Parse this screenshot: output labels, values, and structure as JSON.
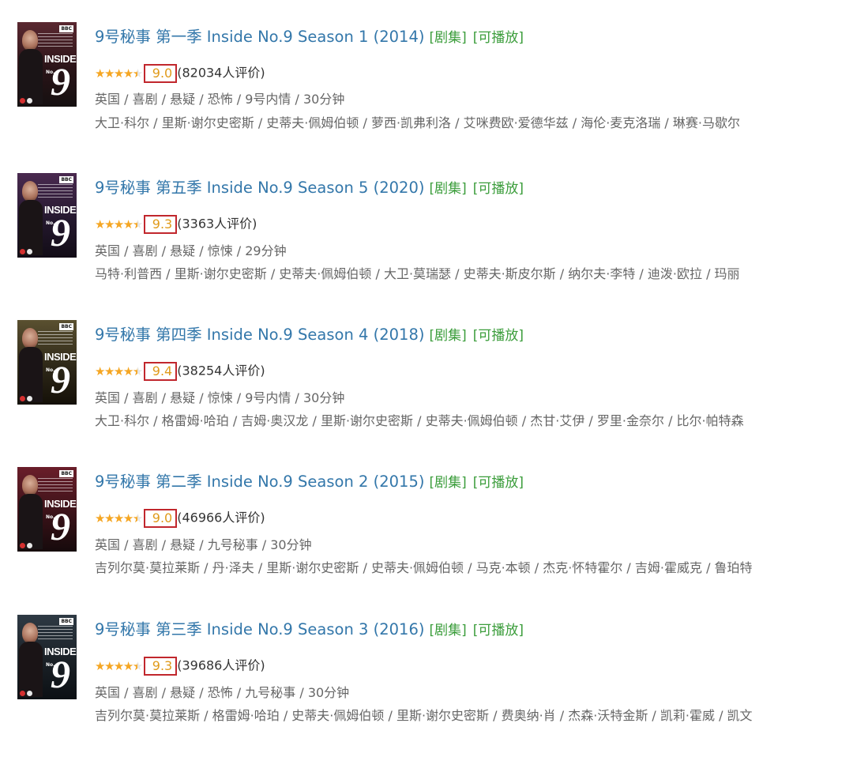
{
  "results": [
    {
      "poster": {
        "channel": "BBC",
        "title_word": "INSIDE",
        "title_number": "9",
        "title_no": "No."
      },
      "title": "9号秘事 第一季 Inside No.9 Season 1 (2014)",
      "tags": [
        "[剧集]",
        "[可播放]"
      ],
      "stars": 4.5,
      "score": "9.0",
      "count_text": "(82034人评价)",
      "meta": "英国 / 喜剧 / 悬疑 / 恐怖 / 9号内情 / 30分钟",
      "cast": "大卫·科尔 / 里斯·谢尔史密斯 / 史蒂夫·佩姆伯顿 / 萝西·凯弗利洛 / 艾咪费欧·爱德华兹 / 海伦·麦克洛瑞 / 琳赛·马歇尔"
    },
    {
      "poster": {
        "channel": "BBC",
        "title_word": "INSIDE",
        "title_number": "9",
        "title_no": "No."
      },
      "title": "9号秘事 第五季 Inside No.9 Season 5 (2020)",
      "tags": [
        "[剧集]",
        "[可播放]"
      ],
      "stars": 4.5,
      "score": "9.3",
      "count_text": "(3363人评价)",
      "meta": "英国 / 喜剧 / 悬疑 / 惊悚 / 29分钟",
      "cast": "马特·利普西 / 里斯·谢尔史密斯 / 史蒂夫·佩姆伯顿 / 大卫·莫瑞瑟 / 史蒂夫·斯皮尔斯 / 纳尔夫·李特 / 迪泼·欧拉 / 玛丽"
    },
    {
      "poster": {
        "channel": "BBC",
        "title_word": "INSIDE",
        "title_number": "9",
        "title_no": "No."
      },
      "title": "9号秘事 第四季 Inside No.9 Season 4 (2018)",
      "tags": [
        "[剧集]",
        "[可播放]"
      ],
      "stars": 4.5,
      "score": "9.4",
      "count_text": "(38254人评价)",
      "meta": "英国 / 喜剧 / 悬疑 / 惊悚 / 9号内情 / 30分钟",
      "cast": "大卫·科尔 / 格雷姆·哈珀 / 吉姆·奥汉龙 / 里斯·谢尔史密斯 / 史蒂夫·佩姆伯顿 / 杰甘·艾伊 / 罗里·金奈尔 / 比尔·帕特森"
    },
    {
      "poster": {
        "channel": "BBC",
        "title_word": "INSIDE",
        "title_number": "9",
        "title_no": "No."
      },
      "title": "9号秘事 第二季 Inside No.9 Season 2 (2015)",
      "tags": [
        "[剧集]",
        "[可播放]"
      ],
      "stars": 4.5,
      "score": "9.0",
      "count_text": "(46966人评价)",
      "meta": "英国 / 喜剧 / 悬疑 / 九号秘事 / 30分钟",
      "cast": "吉列尔莫·莫拉莱斯 / 丹·泽夫 / 里斯·谢尔史密斯 / 史蒂夫·佩姆伯顿 / 马克·本顿 / 杰克·怀特霍尔 / 吉姆·霍威克 / 鲁珀特"
    },
    {
      "poster": {
        "channel": "BBC",
        "title_word": "INSIDE",
        "title_number": "9",
        "title_no": "No."
      },
      "title": "9号秘事 第三季 Inside No.9 Season 3 (2016)",
      "tags": [
        "[剧集]",
        "[可播放]"
      ],
      "stars": 4.5,
      "score": "9.3",
      "count_text": "(39686人评价)",
      "meta": "英国 / 喜剧 / 悬疑 / 恐怖 / 九号秘事 / 30分钟",
      "cast": "吉列尔莫·莫拉莱斯 / 格雷姆·哈珀 / 史蒂夫·佩姆伯顿 / 里斯·谢尔史密斯 / 费奥纳·肖 / 杰森·沃特金斯 / 凯莉·霍威 / 凯文"
    }
  ],
  "colors": {
    "title_link": "#3377aa",
    "tag": "#3b9d3b",
    "star": "#f5a623",
    "score": "#e09a1a",
    "highlight_box": "#c1272d",
    "meta_text": "#666666"
  },
  "icons": {
    "star": "star-icon"
  }
}
